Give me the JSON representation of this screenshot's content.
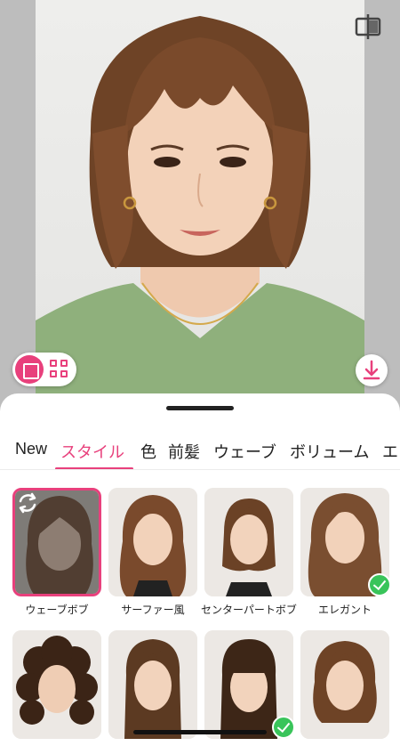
{
  "header": {
    "compare_icon": "compare-split-icon"
  },
  "view_toggle": {
    "single_icon": "single-view-icon",
    "grid_icon": "grid-view-icon"
  },
  "download": {
    "icon": "download-icon"
  },
  "tabs": [
    {
      "label": "New",
      "active": false
    },
    {
      "label": "スタイル",
      "active": true
    },
    {
      "label": "色",
      "active": false
    },
    {
      "label": "前髪",
      "active": false
    },
    {
      "label": "ウェーブ",
      "active": false
    },
    {
      "label": "ボリューム",
      "active": false
    },
    {
      "label": "エ",
      "active": false
    }
  ],
  "styles": [
    {
      "label": "ウェーブボブ",
      "selected": true,
      "checked": false
    },
    {
      "label": "サーファー風",
      "selected": false,
      "checked": false
    },
    {
      "label": "センターパートボブ",
      "selected": false,
      "checked": false
    },
    {
      "label": "エレガント",
      "selected": false,
      "checked": true
    },
    {
      "label": "",
      "selected": false,
      "checked": false
    },
    {
      "label": "",
      "selected": false,
      "checked": false
    },
    {
      "label": "",
      "selected": false,
      "checked": true
    },
    {
      "label": "",
      "selected": false,
      "checked": false
    }
  ],
  "colors": {
    "accent": "#e8407c",
    "check": "#39c45a"
  }
}
